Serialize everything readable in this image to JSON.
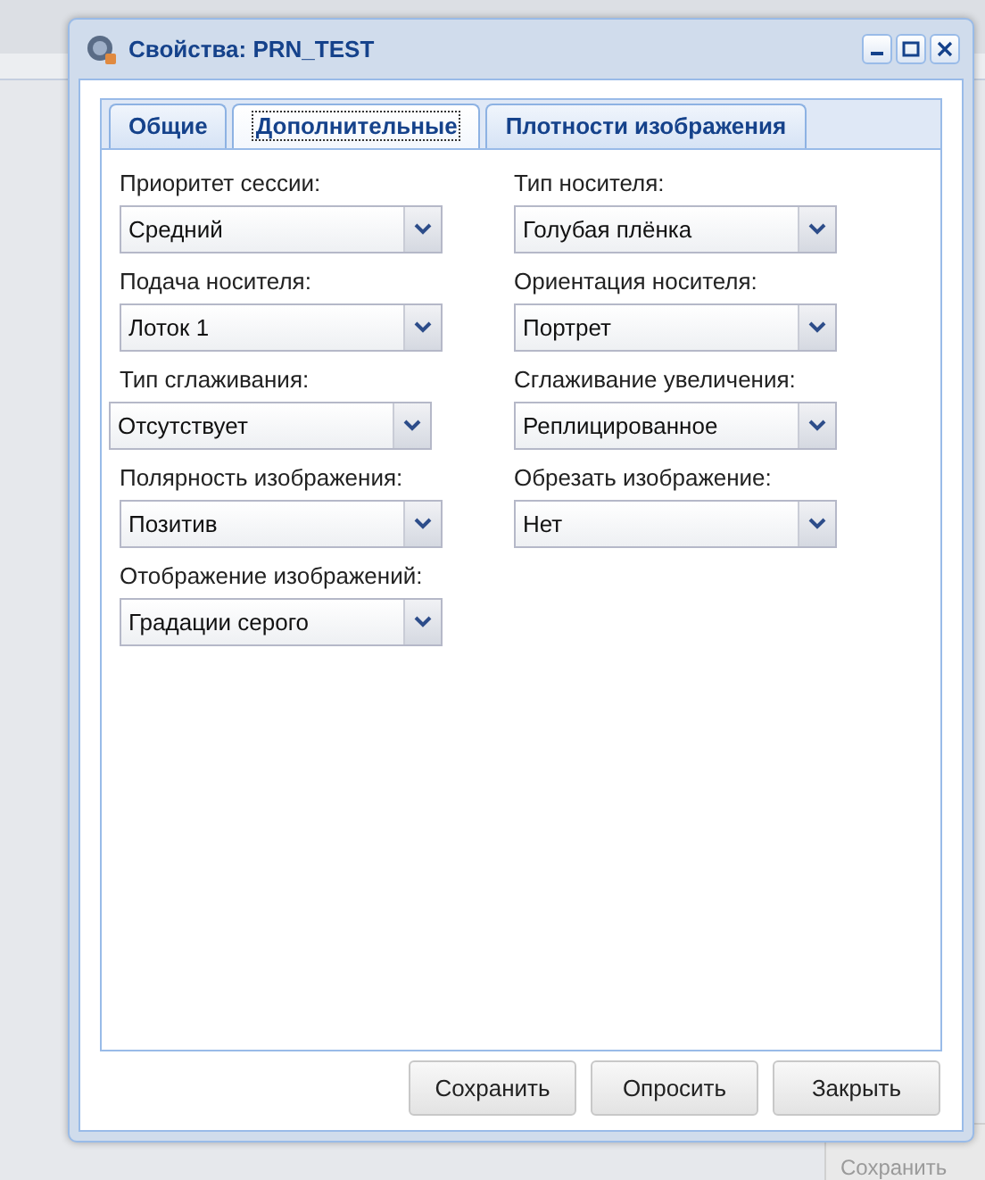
{
  "background": {
    "button": "Сохранить"
  },
  "window": {
    "title": "Свойства: PRN_TEST"
  },
  "tabs": [
    {
      "label": "Общие",
      "selected": false
    },
    {
      "label": "Дополнительные",
      "selected": true
    },
    {
      "label": "Плотности изображения",
      "selected": false
    }
  ],
  "left_column": [
    {
      "label": "Приоритет сессии:",
      "value": "Средний"
    },
    {
      "label": "Подача носителя:",
      "value": "Лоток 1"
    },
    {
      "label": "Тип сглаживания:",
      "value": "Отсутствует"
    },
    {
      "label": "Полярность изображения:",
      "value": "Позитив"
    },
    {
      "label": "Отображение изображений:",
      "value": "Градации серого"
    }
  ],
  "right_column": [
    {
      "label": "Тип носителя:",
      "value": "Голубая плёнка"
    },
    {
      "label": "Ориентация носителя:",
      "value": "Портрет"
    },
    {
      "label": "Сглаживание увеличения:",
      "value": "Реплицированное"
    },
    {
      "label": "Обрезать изображение:",
      "value": "Нет"
    }
  ],
  "buttons": [
    "Сохранить",
    "Опросить",
    "Закрыть"
  ]
}
